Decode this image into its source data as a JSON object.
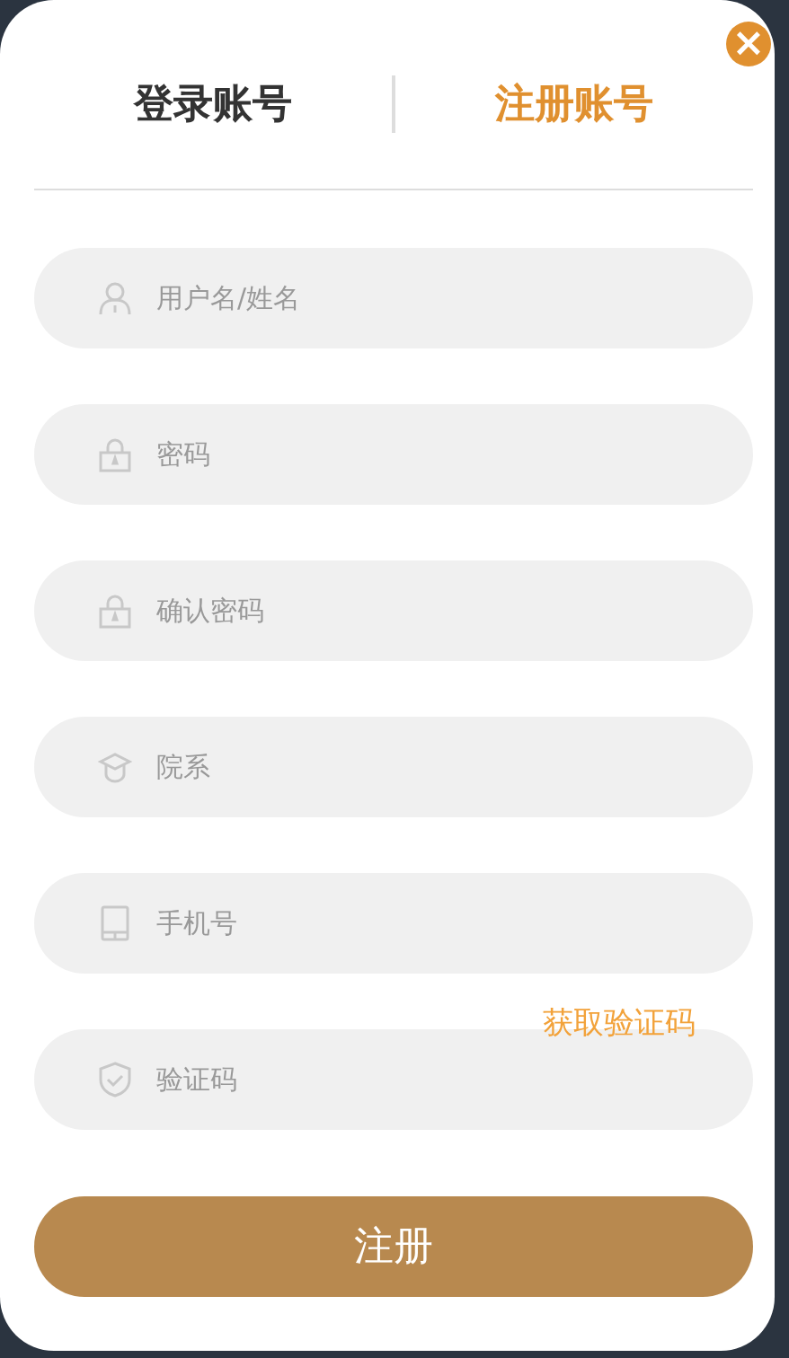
{
  "tabs": [
    {
      "label": "登录账号",
      "selected": false
    },
    {
      "label": "注册账号",
      "selected": true
    }
  ],
  "close_button": {
    "label": "×"
  },
  "fields": [
    {
      "placeholder": "用户名/姓名"
    },
    {
      "placeholder": "密码"
    },
    {
      "placeholder": "确认密码"
    },
    {
      "placeholder": "院系"
    },
    {
      "placeholder": "手机号"
    },
    {
      "placeholder": "验证码"
    }
  ],
  "get_code_link": "获取验证码",
  "submit_button": "注册"
}
